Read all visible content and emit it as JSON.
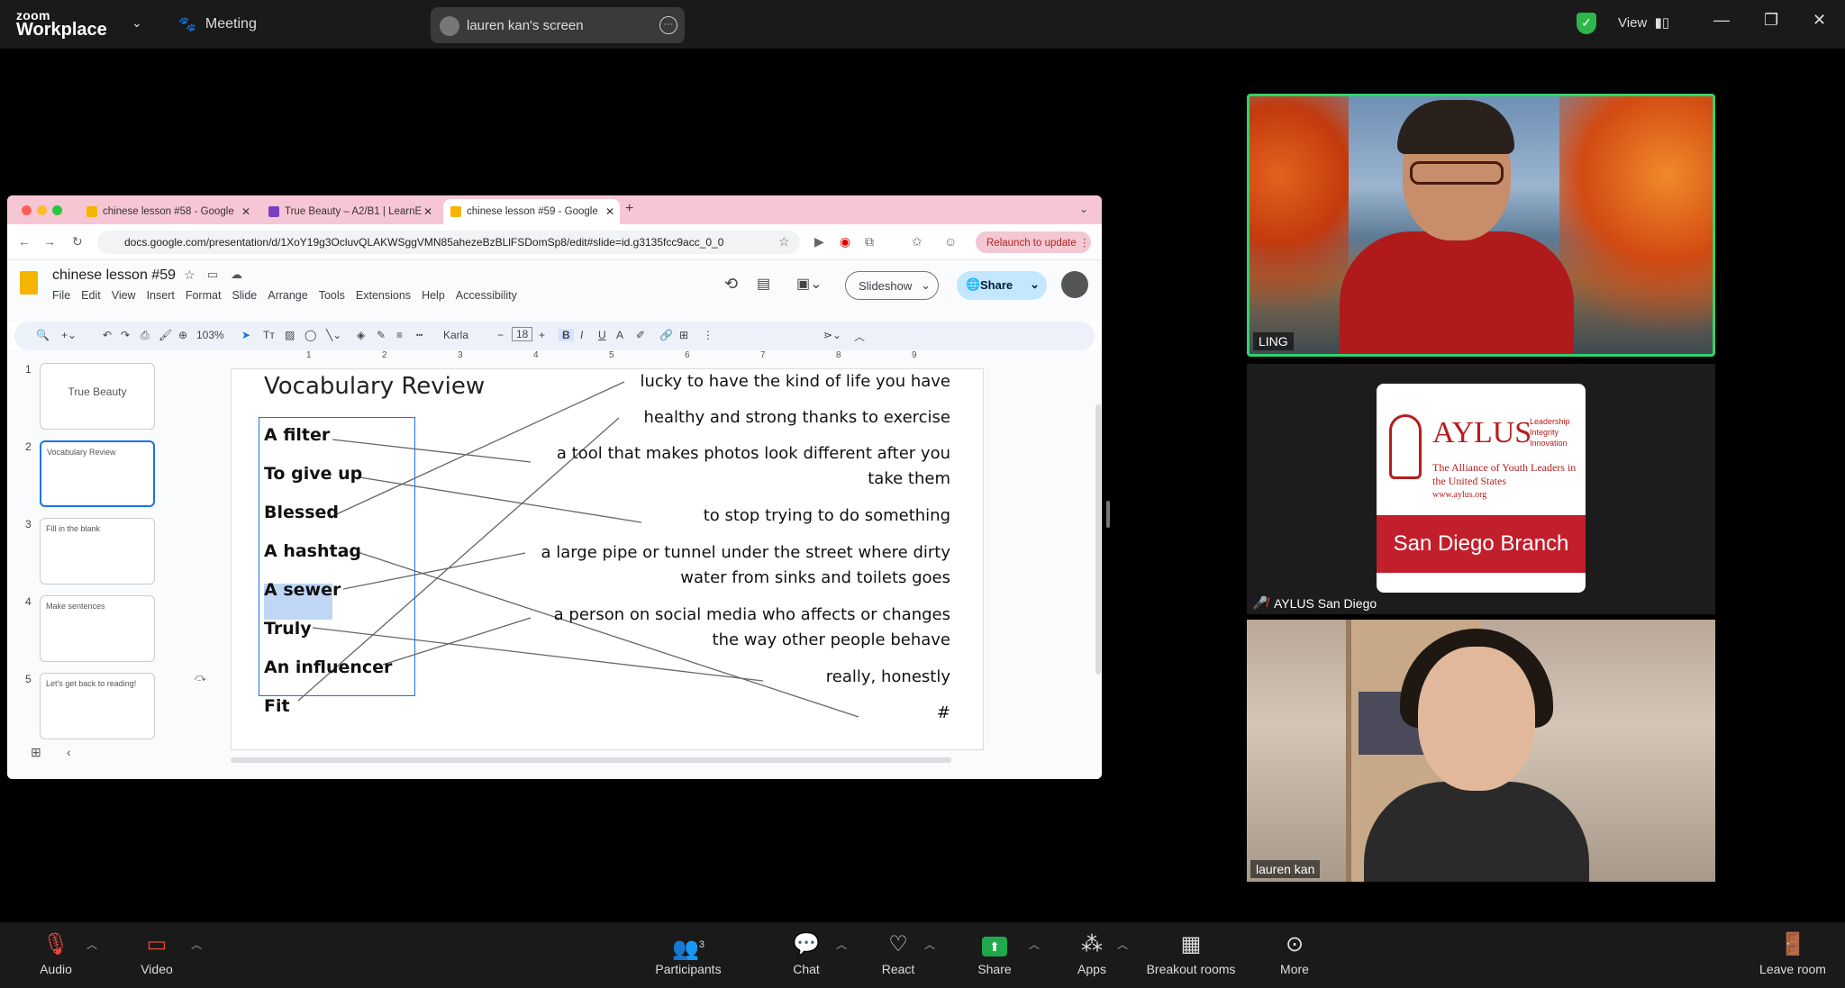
{
  "zoom": {
    "logo_top": "zoom",
    "logo_bottom": "Workplace",
    "meeting_label": "Meeting",
    "screen_share_label": "lauren kan's screen",
    "view_label": "View"
  },
  "browser": {
    "tabs": [
      {
        "label": "chinese lesson #58 - Google"
      },
      {
        "label": "True Beauty – A2/B1 | LearnE"
      },
      {
        "label": "chinese lesson #59 - Google"
      }
    ],
    "url": "docs.google.com/presentation/d/1XoY19g3OcluvQLAKWSggVMN85ahezeBzBLlFSDomSp8/edit#slide=id.g3135fcc9acc_0_0",
    "relaunch_label": "Relaunch to update"
  },
  "docs": {
    "title": "chinese lesson #59",
    "menu": [
      "File",
      "Edit",
      "View",
      "Insert",
      "Format",
      "Slide",
      "Arrange",
      "Tools",
      "Extensions",
      "Help",
      "Accessibility"
    ],
    "slideshow_label": "Slideshow",
    "share_label": "Share",
    "zoom_level": "103%",
    "font_name": "Karla",
    "font_size": "18",
    "ruler_ticks": [
      "1",
      "2",
      "3",
      "4",
      "5",
      "6",
      "7",
      "8",
      "9"
    ],
    "thumbnails": [
      {
        "num": "1",
        "text": "True Beauty"
      },
      {
        "num": "2",
        "text": "Vocabulary Review"
      },
      {
        "num": "3",
        "text": "Fill in the blank"
      },
      {
        "num": "4",
        "text": "Make sentences"
      },
      {
        "num": "5",
        "text": "Let's get back to reading!"
      }
    ]
  },
  "slide": {
    "title": "Vocabulary Review",
    "terms": [
      "A filter",
      "To give up",
      "Blessed",
      "A hashtag",
      "A sewer",
      "Truly",
      "An influencer",
      "Fit"
    ],
    "definitions": [
      "lucky to have the kind of life you have",
      "healthy and strong thanks to exercise",
      "a tool that makes photos look different after you take them",
      "to stop trying to do something",
      "a large pipe or tunnel under the street where dirty water from sinks and toilets goes",
      "a person on social media who affects or changes the way other people behave",
      "really, honestly",
      "#"
    ]
  },
  "participants": {
    "ling_name": "LING",
    "aylus_name": "AYLUS San Diego",
    "aylus_logo_text": "AYLUS",
    "aylus_tagline": "Leadership Integrity Innovation",
    "aylus_subtitle": "The Alliance of Youth Leaders in the United States",
    "aylus_url": "www.aylus.org",
    "aylus_branch": "San Diego Branch",
    "lauren_name": "lauren kan"
  },
  "toolbar": {
    "audio": "Audio",
    "video": "Video",
    "participants": "Participants",
    "participants_count": "3",
    "chat": "Chat",
    "react": "React",
    "share": "Share",
    "apps": "Apps",
    "breakout": "Breakout rooms",
    "more": "More",
    "leave": "Leave room"
  }
}
